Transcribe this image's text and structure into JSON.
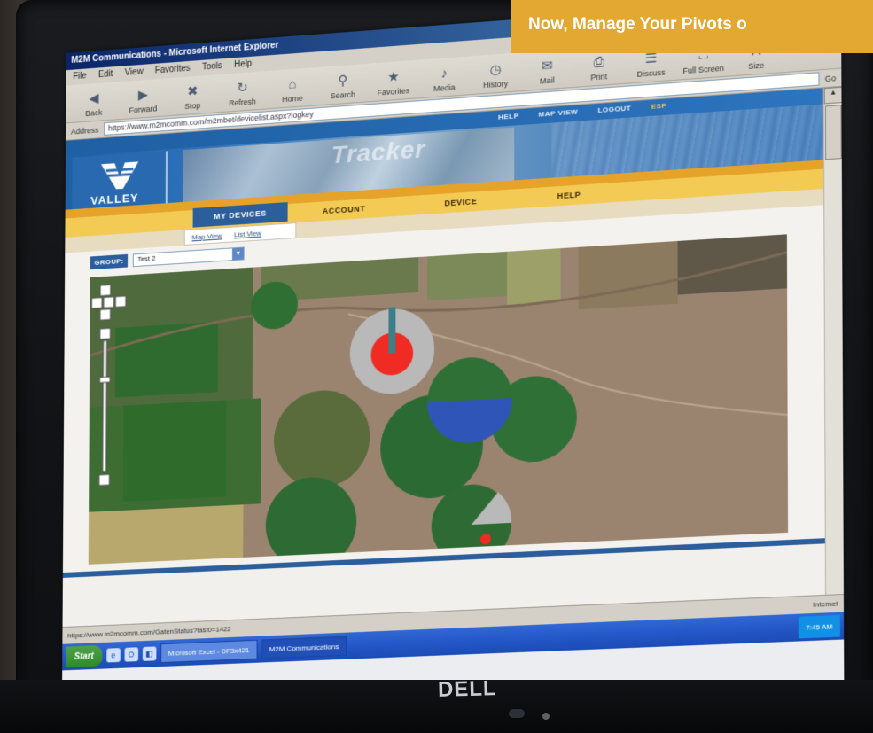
{
  "promo": {
    "headline": "Now, Manage Your Pivots o"
  },
  "browser": {
    "window_title": "M2M Communications - Microsoft Internet Explorer",
    "menu": [
      "File",
      "Edit",
      "View",
      "Favorites",
      "Tools",
      "Help"
    ],
    "toolbar": [
      {
        "label": "Back",
        "icon": "back-arrow-icon"
      },
      {
        "label": "Forward",
        "icon": "forward-arrow-icon"
      },
      {
        "label": "Stop",
        "icon": "stop-icon"
      },
      {
        "label": "Refresh",
        "icon": "refresh-icon"
      },
      {
        "label": "Home",
        "icon": "home-icon"
      },
      {
        "label": "Search",
        "icon": "search-icon"
      },
      {
        "label": "Favorites",
        "icon": "favorites-icon"
      },
      {
        "label": "Media",
        "icon": "media-icon"
      },
      {
        "label": "History",
        "icon": "history-icon"
      },
      {
        "label": "Mail",
        "icon": "mail-icon"
      },
      {
        "label": "Print",
        "icon": "print-icon"
      },
      {
        "label": "Discuss",
        "icon": "discuss-icon"
      },
      {
        "label": "Full Screen",
        "icon": "fullscreen-icon"
      },
      {
        "label": "Size",
        "icon": "size-icon"
      }
    ],
    "address_label": "Address",
    "address_value": "https://www.m2mcomm.com/m2mbet/devicelist.aspx?logkey",
    "go_label": "Go",
    "status_text": "https://www.m2mcomm.com/GatenStatus?last0=1422",
    "status_zone": "Internet"
  },
  "site": {
    "top_links": [
      "HELP",
      "MAP VIEW",
      "LOGOUT",
      "ESP"
    ],
    "logo_text": "VALLEY",
    "banner_word": "Tracker",
    "nav": {
      "my_devices": "MY DEVICES",
      "account": "ACCOUNT",
      "device": "DEVICE",
      "help": "HELP"
    },
    "subnav": [
      "Map View",
      "List View"
    ],
    "group_label": "GROUP:",
    "group_value": "Test 2"
  },
  "taskbar": {
    "start": "Start",
    "tasks": [
      "Microsoft Excel - DF3x421",
      "M2M Communications"
    ],
    "clock": "7:45 AM"
  },
  "brand": "DELL",
  "colors": {
    "promo_bg": "#e2a831",
    "header_blue": "#2b5e9a",
    "nav_gold": "#f2ca54",
    "pivot_status_red": "#ef2b24",
    "pivot_status_blue": "#2f55b8",
    "pivot_idle_gray": "#b9b9b9"
  }
}
